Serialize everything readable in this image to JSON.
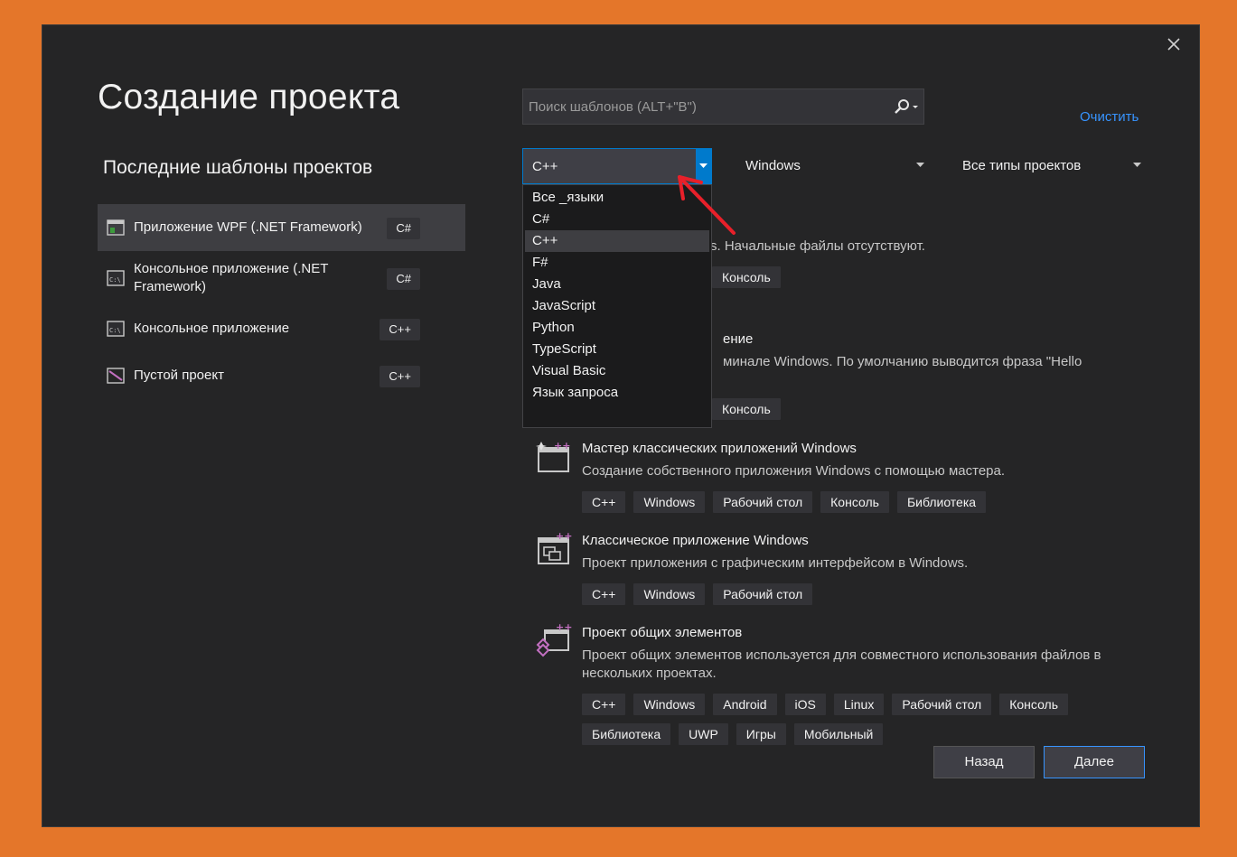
{
  "dialog": {
    "title": "Создание проекта",
    "close_icon": "close-icon"
  },
  "recent": {
    "title": "Последние шаблоны проектов",
    "items": [
      {
        "label": "Приложение WPF (.NET Framework)",
        "lang": "C#",
        "icon": "wpf-app-icon",
        "selected": true
      },
      {
        "label": "Консольное приложение (.NET Framework)",
        "lang": "C#",
        "icon": "console-app-icon",
        "selected": false
      },
      {
        "label": "Консольное приложение",
        "lang": "C++",
        "icon": "console-app-icon",
        "selected": false
      },
      {
        "label": "Пустой проект",
        "lang": "C++",
        "icon": "empty-project-icon",
        "selected": false
      }
    ]
  },
  "search": {
    "placeholder": "Поиск шаблонов (ALT+\"В\")",
    "icon": "search-icon"
  },
  "clear_label": "Очистить",
  "filters": {
    "language": "C++",
    "platform": "Windows",
    "project_type": "Все типы проектов"
  },
  "language_dropdown": {
    "options": [
      "Все _языки",
      "C#",
      "C++",
      "F#",
      "Java",
      "JavaScript",
      "Python",
      "TypeScript",
      "Visual Basic",
      "Язык запроса"
    ],
    "selected": "C++"
  },
  "templates": [
    {
      "name": "",
      "description": "зуя C++ для Windows. Начальные файлы отсутствуют.",
      "tags": [
        "Консоль"
      ]
    },
    {
      "name": "ение",
      "description": "минале Windows. По умолчанию выводится фраза \"Hello",
      "tags": [
        "Консоль"
      ]
    },
    {
      "name": "Мастер классических приложений Windows",
      "description": "Создание собственного приложения Windows с помощью мастера.",
      "tags": [
        "C++",
        "Windows",
        "Рабочий стол",
        "Консоль",
        "Библиотека"
      ],
      "icon": "desktop-wizard-icon"
    },
    {
      "name": "Классическое приложение Windows",
      "description": "Проект приложения с графическим интерфейсом в Windows.",
      "tags": [
        "C++",
        "Windows",
        "Рабочий стол"
      ],
      "icon": "desktop-app-icon"
    },
    {
      "name": "Проект общих элементов",
      "description": "Проект общих элементов используется для совместного использования файлов в нескольких проектах.",
      "tags": [
        "C++",
        "Windows",
        "Android",
        "iOS",
        "Linux",
        "Рабочий стол",
        "Консоль",
        "Библиотека",
        "UWP",
        "Игры",
        "Мобильный"
      ],
      "icon": "shared-items-icon"
    }
  ],
  "buttons": {
    "back": "Назад",
    "next": "Далее"
  },
  "colors": {
    "page_bg": "#e4762a",
    "dialog_bg": "#252526",
    "accent": "#007acc",
    "link": "#3794ff",
    "annotation_arrow": "#e8202a"
  }
}
